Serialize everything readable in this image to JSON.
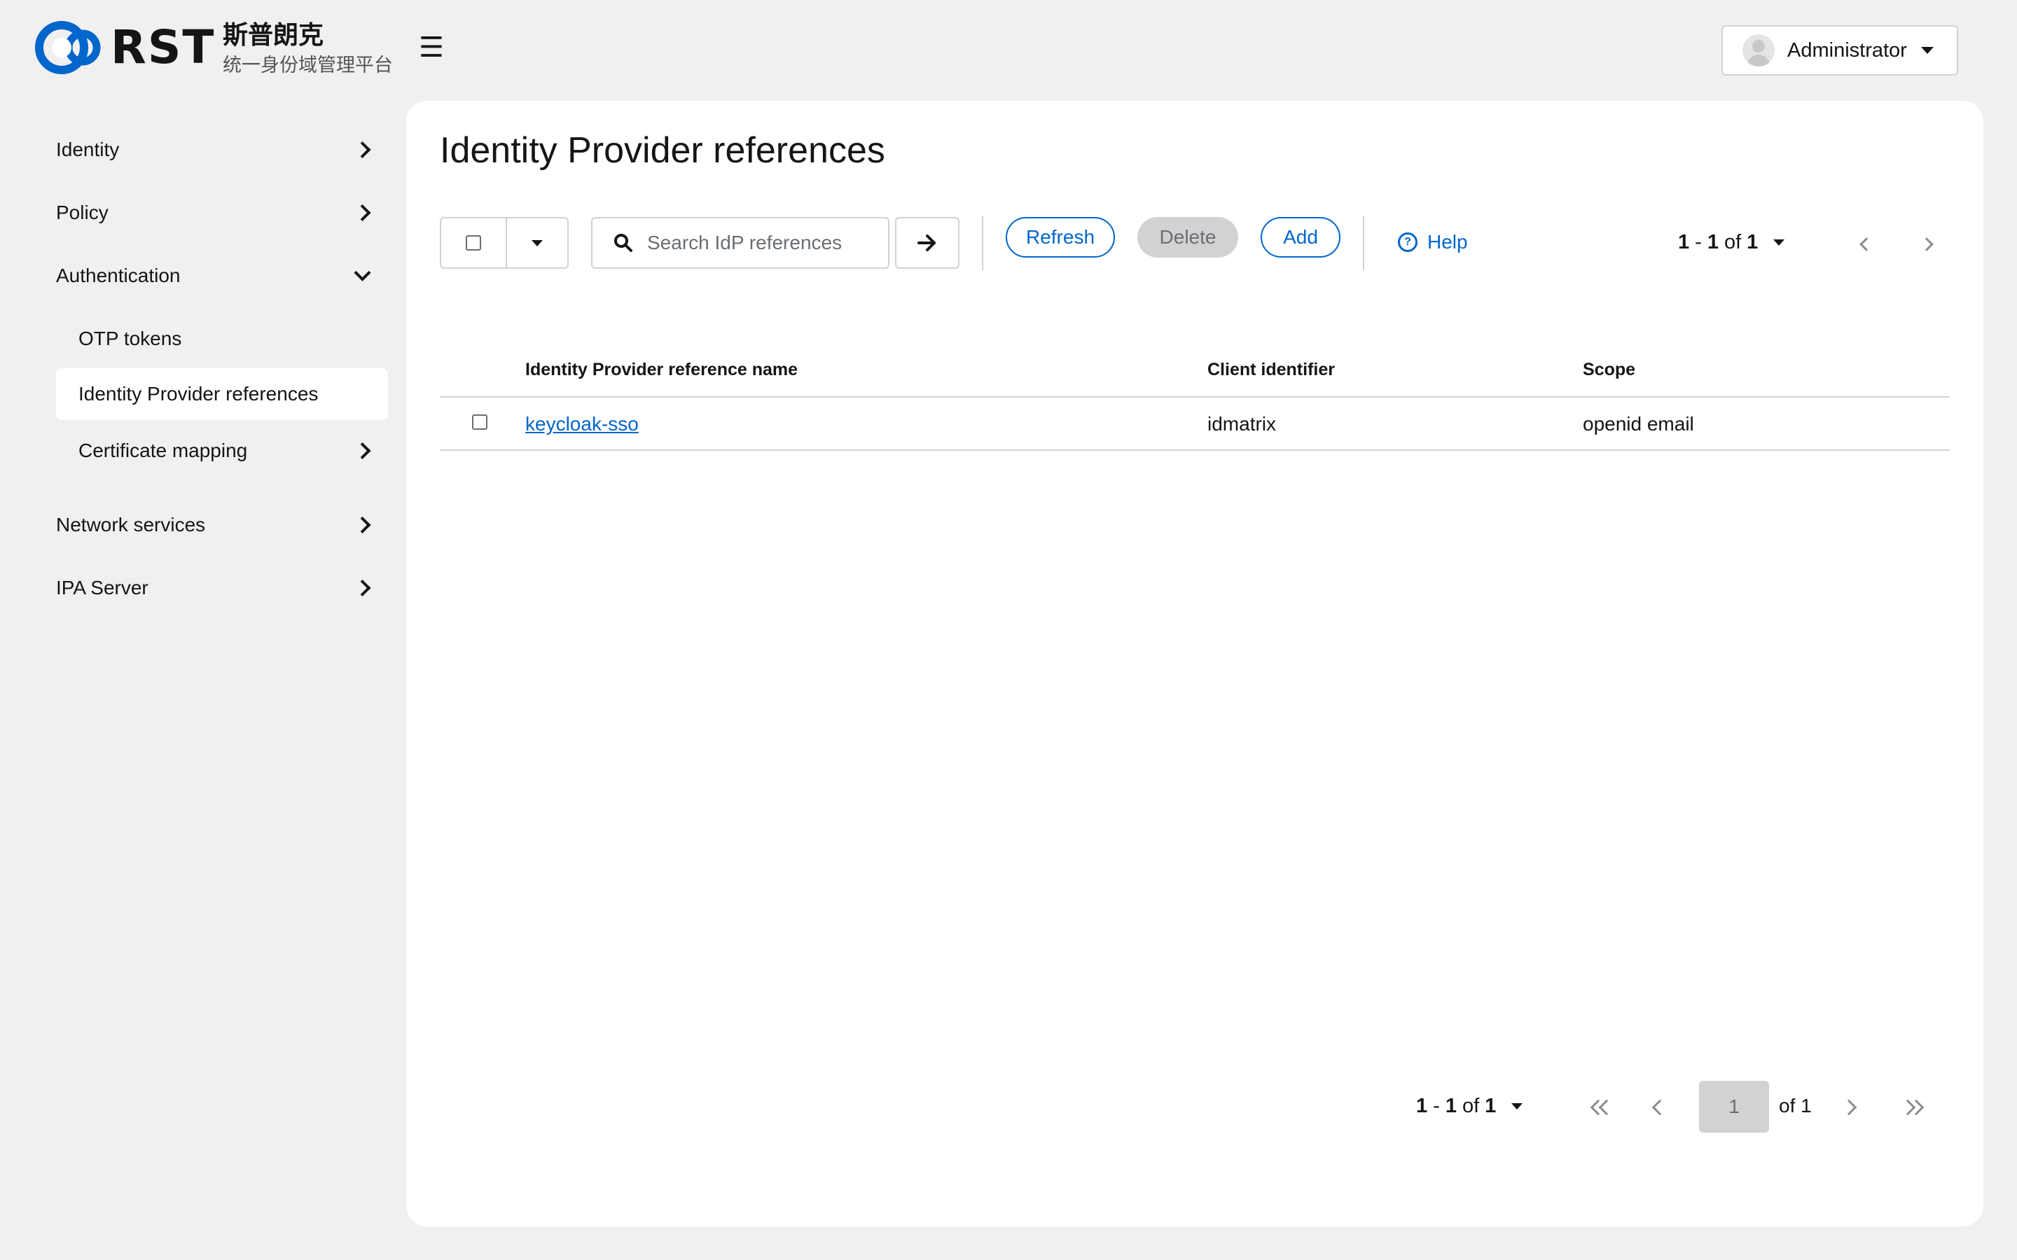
{
  "brand": {
    "logo_text": "RST",
    "title_cn": "斯普朗克",
    "subtitle_cn": "统一身份域管理平台",
    "brand_color": "#0066cc"
  },
  "header": {
    "menu_icon": "☰",
    "user_name": "Administrator"
  },
  "sidebar": {
    "items": [
      {
        "label": "Identity"
      },
      {
        "label": "Policy"
      },
      {
        "label": "Authentication"
      },
      {
        "label": "OTP tokens"
      },
      {
        "label": "Identity Provider references"
      },
      {
        "label": "Certificate mapping"
      },
      {
        "label": "Network services"
      },
      {
        "label": "IPA Server"
      }
    ]
  },
  "main": {
    "title": "Identity Provider references",
    "toolbar": {
      "search_placeholder": "Search IdP references",
      "refresh_label": "Refresh",
      "delete_label": "Delete",
      "add_label": "Add",
      "help_label": "Help"
    },
    "pagination": {
      "range_start": "1",
      "range_end": "1",
      "of_label": "of",
      "total": "1",
      "current_page": "1",
      "page_total_label": "of 1"
    },
    "table": {
      "columns": [
        "Identity Provider reference name",
        "Client identifier",
        "Scope"
      ],
      "rows": [
        {
          "name": "keycloak-sso",
          "client_id": "idmatrix",
          "scope": "openid email"
        }
      ]
    }
  }
}
